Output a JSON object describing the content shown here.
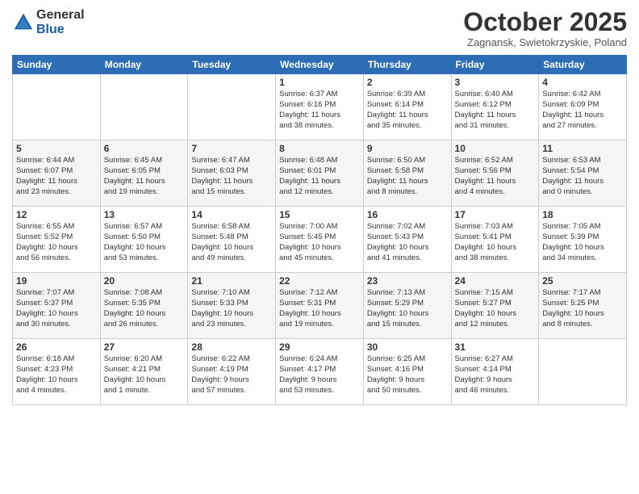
{
  "header": {
    "logo_general": "General",
    "logo_blue": "Blue",
    "month_title": "October 2025",
    "location": "Zagnansk, Swietokrzyskie, Poland"
  },
  "days_of_week": [
    "Sunday",
    "Monday",
    "Tuesday",
    "Wednesday",
    "Thursday",
    "Friday",
    "Saturday"
  ],
  "weeks": [
    [
      {
        "day": "",
        "info": ""
      },
      {
        "day": "",
        "info": ""
      },
      {
        "day": "",
        "info": ""
      },
      {
        "day": "1",
        "info": "Sunrise: 6:37 AM\nSunset: 6:16 PM\nDaylight: 11 hours\nand 38 minutes."
      },
      {
        "day": "2",
        "info": "Sunrise: 6:39 AM\nSunset: 6:14 PM\nDaylight: 11 hours\nand 35 minutes."
      },
      {
        "day": "3",
        "info": "Sunrise: 6:40 AM\nSunset: 6:12 PM\nDaylight: 11 hours\nand 31 minutes."
      },
      {
        "day": "4",
        "info": "Sunrise: 6:42 AM\nSunset: 6:09 PM\nDaylight: 11 hours\nand 27 minutes."
      }
    ],
    [
      {
        "day": "5",
        "info": "Sunrise: 6:44 AM\nSunset: 6:07 PM\nDaylight: 11 hours\nand 23 minutes."
      },
      {
        "day": "6",
        "info": "Sunrise: 6:45 AM\nSunset: 6:05 PM\nDaylight: 11 hours\nand 19 minutes."
      },
      {
        "day": "7",
        "info": "Sunrise: 6:47 AM\nSunset: 6:03 PM\nDaylight: 11 hours\nand 15 minutes."
      },
      {
        "day": "8",
        "info": "Sunrise: 6:48 AM\nSunset: 6:01 PM\nDaylight: 11 hours\nand 12 minutes."
      },
      {
        "day": "9",
        "info": "Sunrise: 6:50 AM\nSunset: 5:58 PM\nDaylight: 11 hours\nand 8 minutes."
      },
      {
        "day": "10",
        "info": "Sunrise: 6:52 AM\nSunset: 5:56 PM\nDaylight: 11 hours\nand 4 minutes."
      },
      {
        "day": "11",
        "info": "Sunrise: 6:53 AM\nSunset: 5:54 PM\nDaylight: 11 hours\nand 0 minutes."
      }
    ],
    [
      {
        "day": "12",
        "info": "Sunrise: 6:55 AM\nSunset: 5:52 PM\nDaylight: 10 hours\nand 56 minutes."
      },
      {
        "day": "13",
        "info": "Sunrise: 6:57 AM\nSunset: 5:50 PM\nDaylight: 10 hours\nand 53 minutes."
      },
      {
        "day": "14",
        "info": "Sunrise: 6:58 AM\nSunset: 5:48 PM\nDaylight: 10 hours\nand 49 minutes."
      },
      {
        "day": "15",
        "info": "Sunrise: 7:00 AM\nSunset: 5:45 PM\nDaylight: 10 hours\nand 45 minutes."
      },
      {
        "day": "16",
        "info": "Sunrise: 7:02 AM\nSunset: 5:43 PM\nDaylight: 10 hours\nand 41 minutes."
      },
      {
        "day": "17",
        "info": "Sunrise: 7:03 AM\nSunset: 5:41 PM\nDaylight: 10 hours\nand 38 minutes."
      },
      {
        "day": "18",
        "info": "Sunrise: 7:05 AM\nSunset: 5:39 PM\nDaylight: 10 hours\nand 34 minutes."
      }
    ],
    [
      {
        "day": "19",
        "info": "Sunrise: 7:07 AM\nSunset: 5:37 PM\nDaylight: 10 hours\nand 30 minutes."
      },
      {
        "day": "20",
        "info": "Sunrise: 7:08 AM\nSunset: 5:35 PM\nDaylight: 10 hours\nand 26 minutes."
      },
      {
        "day": "21",
        "info": "Sunrise: 7:10 AM\nSunset: 5:33 PM\nDaylight: 10 hours\nand 23 minutes."
      },
      {
        "day": "22",
        "info": "Sunrise: 7:12 AM\nSunset: 5:31 PM\nDaylight: 10 hours\nand 19 minutes."
      },
      {
        "day": "23",
        "info": "Sunrise: 7:13 AM\nSunset: 5:29 PM\nDaylight: 10 hours\nand 15 minutes."
      },
      {
        "day": "24",
        "info": "Sunrise: 7:15 AM\nSunset: 5:27 PM\nDaylight: 10 hours\nand 12 minutes."
      },
      {
        "day": "25",
        "info": "Sunrise: 7:17 AM\nSunset: 5:25 PM\nDaylight: 10 hours\nand 8 minutes."
      }
    ],
    [
      {
        "day": "26",
        "info": "Sunrise: 6:18 AM\nSunset: 4:23 PM\nDaylight: 10 hours\nand 4 minutes."
      },
      {
        "day": "27",
        "info": "Sunrise: 6:20 AM\nSunset: 4:21 PM\nDaylight: 10 hours\nand 1 minute."
      },
      {
        "day": "28",
        "info": "Sunrise: 6:22 AM\nSunset: 4:19 PM\nDaylight: 9 hours\nand 57 minutes."
      },
      {
        "day": "29",
        "info": "Sunrise: 6:24 AM\nSunset: 4:17 PM\nDaylight: 9 hours\nand 53 minutes."
      },
      {
        "day": "30",
        "info": "Sunrise: 6:25 AM\nSunset: 4:16 PM\nDaylight: 9 hours\nand 50 minutes."
      },
      {
        "day": "31",
        "info": "Sunrise: 6:27 AM\nSunset: 4:14 PM\nDaylight: 9 hours\nand 46 minutes."
      },
      {
        "day": "",
        "info": ""
      }
    ]
  ]
}
